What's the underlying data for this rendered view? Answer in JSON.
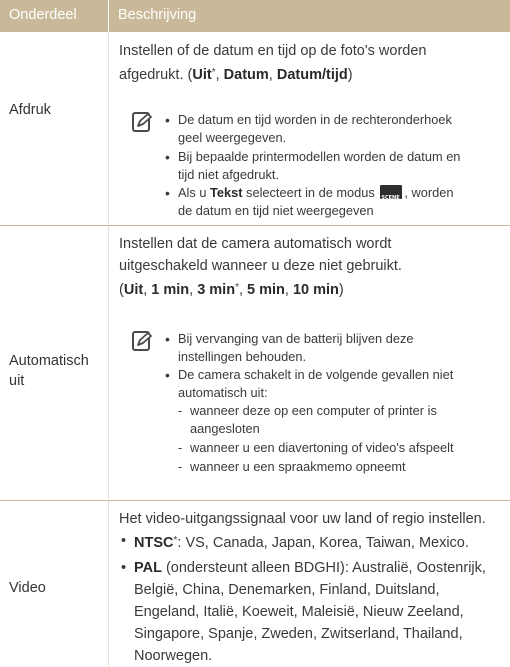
{
  "header": {
    "col1": "Onderdeel",
    "col2": "Beschrijving"
  },
  "afdruk": {
    "label": "Afdruk",
    "desc_line1": "Instellen of de datum en tijd op de foto's worden",
    "desc_line2_pre": "afgedrukt. (",
    "opt_uit": "Uit",
    "opt_uit_mark": "*",
    "sep1": ", ",
    "opt_datum": "Datum",
    "sep2": ", ",
    "opt_datumtijd": "Datum/tijd",
    "desc_close": ")",
    "note_icon": "note-icon",
    "bullets": [
      {
        "l1": "De datum en tijd worden in de rechteronderhoek",
        "l2": "geel weergegeven."
      },
      {
        "l1": "Bij bepaalde printermodellen worden de datum en",
        "l2": "tijd niet afgedrukt."
      }
    ],
    "bullet3_pre": "Als u ",
    "bullet3_bold": "Tekst",
    "bullet3_mid": " selecteert in de modus ",
    "bullet3_icon": "scene-mode-icon",
    "bullet3_post": ", worden",
    "bullet3_l2": "de datum en tijd niet weergegeven"
  },
  "auto": {
    "label_l1": "Automatisch",
    "label_l2": "uit",
    "desc_l1": "Instellen dat de camera automatisch wordt",
    "desc_l2": "uitgeschakeld wanneer u deze niet gebruikt.",
    "open": "(",
    "o1": "Uit",
    "c1": ", ",
    "o2": "1 min",
    "c2": ", ",
    "o3": "3 min",
    "o3_mark": "*",
    "c3": ", ",
    "o4": "5 min",
    "c4": ", ",
    "o5": "10 min",
    "close": ")",
    "note_icon": "note-icon",
    "bullet1_l1": "Bij vervanging van de batterij blijven deze",
    "bullet1_l2": "instellingen behouden.",
    "bullet2_l1": "De camera schakelt in de volgende gevallen niet",
    "bullet2_l2": "automatisch uit:",
    "subs": [
      {
        "l1": "wanneer deze op een computer of printer is",
        "l2": "aangesloten"
      },
      {
        "l1": "wanneer u een diavertoning of video's afspeelt",
        "l2": ""
      },
      {
        "l1": "wanneer u een spraakmemo opneemt",
        "l2": ""
      }
    ]
  },
  "video": {
    "label": "Video",
    "desc": "Het video-uitgangssignaal voor uw land of regio instellen.",
    "ntsc_bold": "NTSC",
    "ntsc_mark": "*",
    "ntsc_text": ": VS, Canada, Japan, Korea, Taiwan, Mexico.",
    "pal_bold": "PAL",
    "pal_l1": " (ondersteunt alleen BDGHI): Australië, Oostenrijk,",
    "pal_l2": "België, China, Denemarken, Finland, Duitsland,",
    "pal_l3": "Engeland, Italië, Koeweit, Maleisië, Nieuw Zeeland,",
    "pal_l4": "Singapore, Spanje, Zweden, Zwitserland, Thailand,",
    "pal_l5": "Noorwegen."
  },
  "colors": {
    "header_bg": "#c9b998",
    "row_line": "#c8b99a"
  }
}
